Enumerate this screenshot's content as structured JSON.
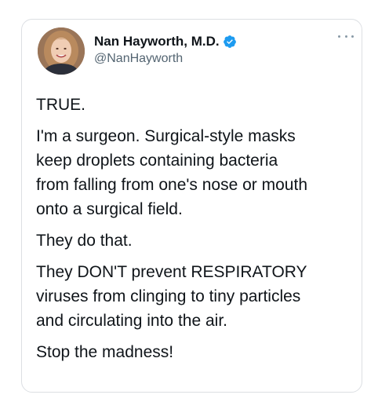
{
  "tweet": {
    "author": {
      "display_name": "Nan Hayworth, M.D.",
      "handle": "@NanHayworth",
      "verified": true
    },
    "paragraphs": [
      {
        "lines": [
          "TRUE."
        ]
      },
      {
        "lines": [
          "I'm a surgeon. Surgical-style masks",
          "keep droplets containing bacteria",
          "from falling from one's nose or mouth",
          "onto a surgical field."
        ]
      },
      {
        "lines": [
          "They do that."
        ]
      },
      {
        "lines": [
          "They DON'T prevent RESPIRATORY",
          "viruses from clinging to tiny particles",
          "and circulating into the air."
        ]
      },
      {
        "lines": [
          "Stop the madness!"
        ]
      }
    ]
  },
  "icons": {
    "verified": "verified-badge-icon",
    "more": "more-options-icon",
    "avatar": "profile-photo"
  },
  "colors": {
    "verified_blue": "#1d9bf0",
    "text": "#0f1419",
    "secondary_text": "#536471",
    "border": "#dcdfe3"
  }
}
